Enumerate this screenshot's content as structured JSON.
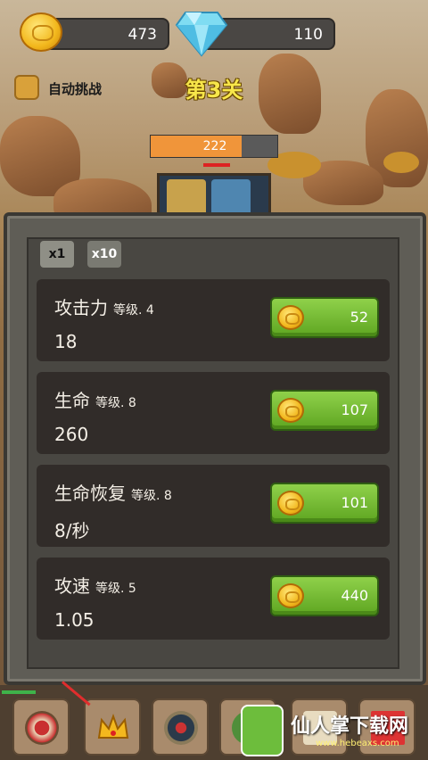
{
  "resources": {
    "coins": "473",
    "gems": "110"
  },
  "auto_battle": {
    "label": "自动挑战"
  },
  "level": {
    "title": "第3关"
  },
  "enemy": {
    "hp": "222",
    "hp_fraction": 0.72
  },
  "multipliers": [
    {
      "label": "x1",
      "active": true
    },
    {
      "label": "x10",
      "active": false
    }
  ],
  "upgrades": [
    {
      "name": "攻击力",
      "level": "等级. 4",
      "value": "18",
      "cost": "52"
    },
    {
      "name": "生命",
      "level": "等级. 8",
      "value": "260",
      "cost": "107"
    },
    {
      "name": "生命恢复",
      "level": "等级. 8",
      "value": "8/秒",
      "cost": "101"
    },
    {
      "name": "攻速",
      "level": "等级. 5",
      "value": "1.05",
      "cost": "440"
    }
  ],
  "bottom_tabs": [
    {
      "icon": "target-icon"
    },
    {
      "icon": "crown-icon"
    },
    {
      "icon": "shield-icon"
    },
    {
      "icon": "tree-icon"
    },
    {
      "icon": "scroll-icon"
    },
    {
      "icon": "flag-icon"
    }
  ],
  "watermark": {
    "text": "仙人掌下载网",
    "url": "www.hebeaxs.com"
  },
  "colors": {
    "accent_green": "#6cb62c",
    "title_yellow": "#f7e64a",
    "hp_orange": "#f0953a"
  }
}
